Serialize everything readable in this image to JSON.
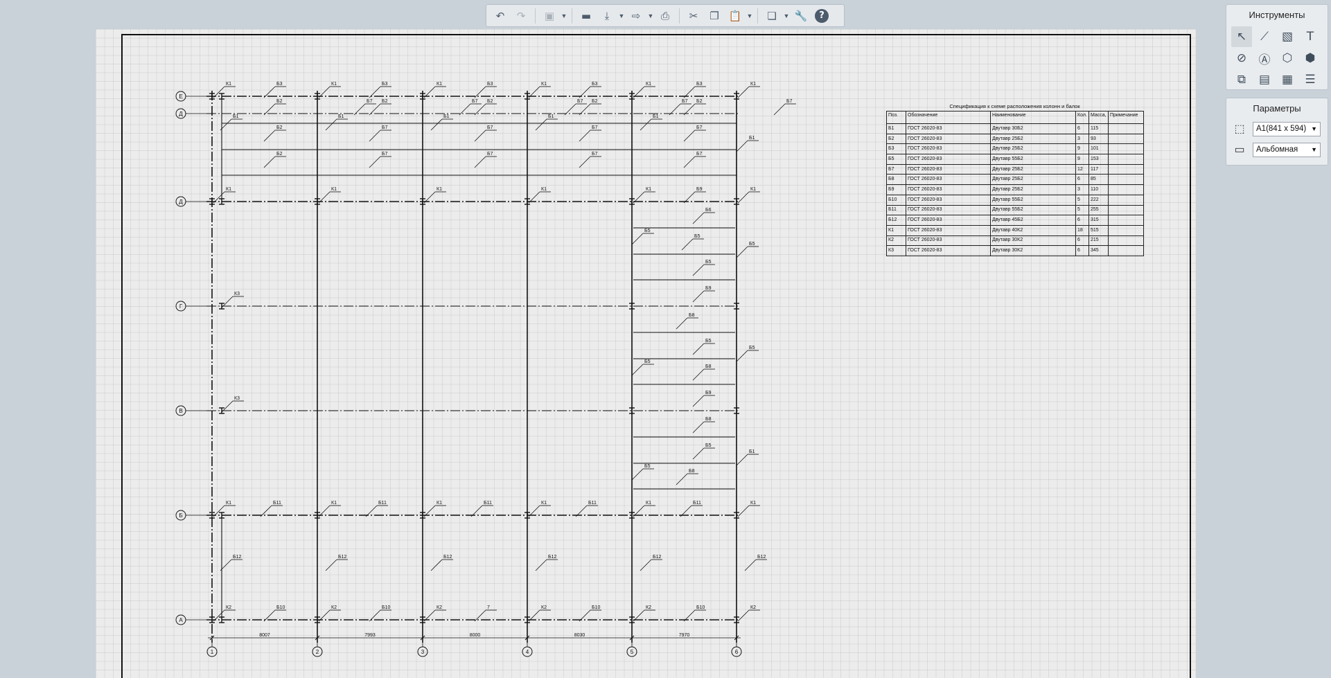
{
  "toolbar": {
    "buttons": [
      {
        "name": "undo-button",
        "icon": "undo-icon",
        "glyph": "↶",
        "disabled": false
      },
      {
        "name": "redo-button",
        "icon": "redo-icon",
        "glyph": "↷",
        "disabled": true
      },
      {
        "name": "3d-view-button",
        "icon": "cube-icon",
        "glyph": "▣",
        "disabled": true
      },
      {
        "name": "open-button",
        "icon": "folder-icon",
        "glyph": "▬",
        "disabled": false
      },
      {
        "name": "save-button",
        "icon": "download-icon",
        "glyph": "⤓",
        "disabled": false
      },
      {
        "name": "export-button",
        "icon": "export-icon",
        "glyph": "⇨",
        "disabled": false
      },
      {
        "name": "print-button",
        "icon": "printer-icon",
        "glyph": "⎙",
        "disabled": false
      },
      {
        "name": "cut-button",
        "icon": "scissors-icon",
        "glyph": "✂",
        "disabled": false
      },
      {
        "name": "copy-button",
        "icon": "copy-icon",
        "glyph": "❐",
        "disabled": false
      },
      {
        "name": "paste-button",
        "icon": "paste-icon",
        "glyph": "📋",
        "disabled": false
      },
      {
        "name": "layers-button",
        "icon": "layers-icon",
        "glyph": "❏",
        "disabled": false
      },
      {
        "name": "settings-button",
        "icon": "wrench-icon",
        "glyph": "🔧",
        "disabled": false
      },
      {
        "name": "help-button",
        "icon": "help-icon",
        "glyph": "?",
        "disabled": false
      }
    ]
  },
  "tools_panel": {
    "title": "Инструменты",
    "tools": [
      {
        "name": "select-tool",
        "icon": "cursor-icon",
        "glyph": "↖",
        "active": true
      },
      {
        "name": "line-tool",
        "icon": "polyline-icon",
        "glyph": "⟋",
        "active": false
      },
      {
        "name": "hatch-tool",
        "icon": "hatch-icon",
        "glyph": "▧",
        "active": false
      },
      {
        "name": "text-tool",
        "icon": "text-icon",
        "glyph": "T",
        "active": false
      },
      {
        "name": "dimension-tool",
        "icon": "dimension-icon",
        "glyph": "⊘",
        "active": false
      },
      {
        "name": "marker-tool",
        "icon": "marker-icon",
        "glyph": "Ⓐ",
        "active": false
      },
      {
        "name": "view-tool",
        "icon": "view-icon",
        "glyph": "⬡",
        "active": false
      },
      {
        "name": "model-tool",
        "icon": "box-icon",
        "glyph": "⬢",
        "active": false
      },
      {
        "name": "sheet-tool",
        "icon": "sheet-format-icon",
        "glyph": "⧉",
        "active": false
      },
      {
        "name": "spec-tool",
        "icon": "specification-icon",
        "glyph": "▤",
        "active": false
      },
      {
        "name": "table-tool",
        "icon": "table-icon",
        "glyph": "▦",
        "active": false
      },
      {
        "name": "list-tool",
        "icon": "list-icon",
        "glyph": "☰",
        "active": false
      }
    ]
  },
  "params_panel": {
    "title": "Параметры",
    "format_value": "A1(841 x 594)",
    "orientation_value": "Альбомная"
  },
  "spec_table": {
    "title": "Спецификация к схеме расположения колонн и балок",
    "headers": [
      "Поз.",
      "Обозначение",
      "Наименование",
      "Кол.",
      "Масса, кг",
      "Примечание"
    ],
    "rows": [
      [
        "Б1",
        "ГОСТ 26020-83",
        "Двутавр 30Б2",
        "6",
        "115",
        ""
      ],
      [
        "Б2",
        "ГОСТ 26020-83",
        "Двутавр 25Б2",
        "3",
        "93",
        ""
      ],
      [
        "Б3",
        "ГОСТ 26020-83",
        "Двутавр 25Б2",
        "9",
        "101",
        ""
      ],
      [
        "Б5",
        "ГОСТ 26020-83",
        "Двутавр 55Б2",
        "9",
        "153",
        ""
      ],
      [
        "Б7",
        "ГОСТ 26020-83",
        "Двутавр 25Б2",
        "12",
        "117",
        ""
      ],
      [
        "Б8",
        "ГОСТ 26020-83",
        "Двутавр 25Б2",
        "6",
        "85",
        ""
      ],
      [
        "Б9",
        "ГОСТ 26020-83",
        "Двутавр 25Б2",
        "3",
        "110",
        ""
      ],
      [
        "Б10",
        "ГОСТ 26020-83",
        "Двутавр 55Б2",
        "5",
        "222",
        ""
      ],
      [
        "Б11",
        "ГОСТ 26020-83",
        "Двутавр 55Б2",
        "5",
        "255",
        ""
      ],
      [
        "Б12",
        "ГОСТ 26020-83",
        "Двутавр 45Б2",
        "6",
        "315",
        ""
      ],
      [
        "К1",
        "ГОСТ 26020-83",
        "Двутавр 40К2",
        "18",
        "515",
        ""
      ],
      [
        "К2",
        "ГОСТ 26020-83",
        "Двутавр 30К2",
        "6",
        "215",
        ""
      ],
      [
        "К3",
        "ГОСТ 26020-83",
        "Двутавр 30К2",
        "6",
        "345",
        ""
      ]
    ]
  },
  "drawing": {
    "row_axes": [
      "Е",
      "Д",
      "Д",
      "Г",
      "В",
      "Б",
      "А"
    ],
    "col_axes": [
      "1",
      "2",
      "3",
      "4",
      "5",
      "6"
    ],
    "dimensions": [
      "8007",
      "7993",
      "8000",
      "8030",
      "7970"
    ],
    "labels": {
      "k1": "К1",
      "k2": "К2",
      "k3": "К3",
      "b1": "Б1",
      "b2": "Б2",
      "b3": "Б3",
      "b5": "Б5",
      "b6": "Б6",
      "b7": "Б7",
      "b8": "Б8",
      "b9": "Б9",
      "b10": "Б10",
      "b11": "Б11",
      "b12": "Б12",
      "seven": "7"
    }
  }
}
